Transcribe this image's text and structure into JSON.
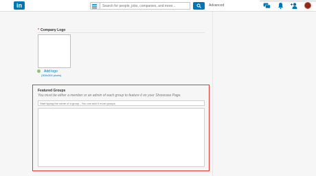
{
  "header": {
    "logo_text": "in",
    "search_placeholder": "Search for people, jobs, companies, and more...",
    "advanced_label": "Advanced",
    "icons": [
      "menu-icon",
      "search-icon",
      "messages-icon",
      "notifications-icon",
      "add-connections-icon",
      "avatar"
    ]
  },
  "company_logo": {
    "required_mark": "*",
    "label": "Company Logo",
    "add_logo_label": "Add logo",
    "size_hint": "(300x300 pixels)"
  },
  "featured_groups": {
    "title": "Featured Groups",
    "description": "You must be either a member or an admin of each group to feature it on your Showcase Page.",
    "input_placeholder": "Start typing the name of a group - You can add 0 more groups"
  },
  "colors": {
    "brand": "#0077b5",
    "highlight_outline": "#e53935"
  }
}
